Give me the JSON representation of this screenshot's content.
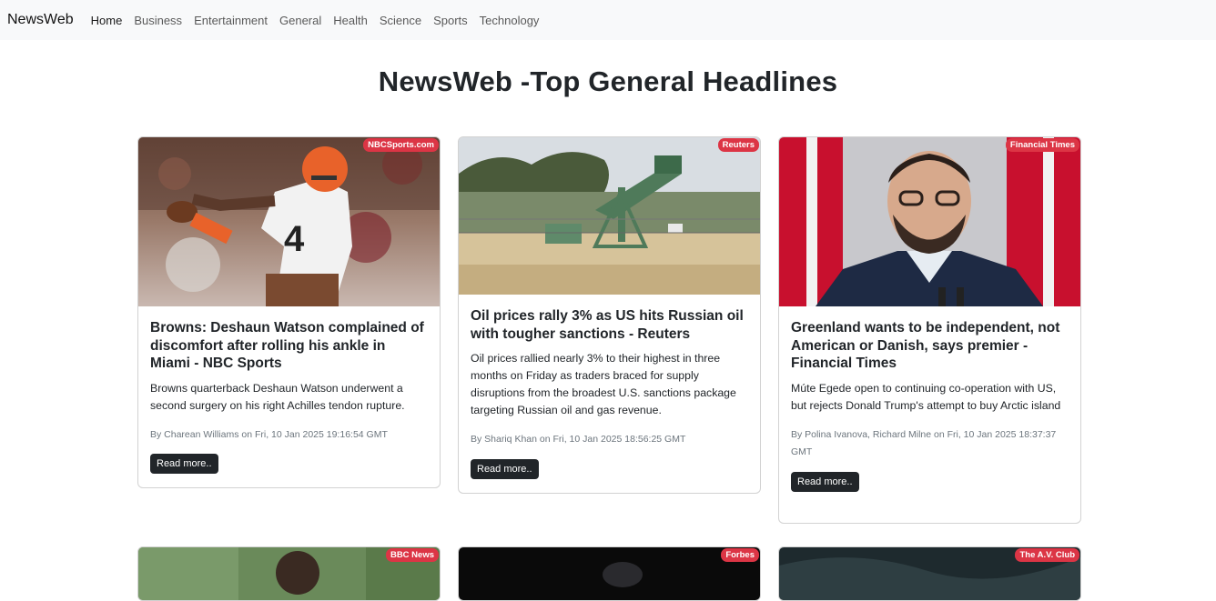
{
  "nav": {
    "brand": "NewsWeb",
    "links": [
      "Home",
      "Business",
      "Entertainment",
      "General",
      "Health",
      "Science",
      "Sports",
      "Technology"
    ]
  },
  "page": {
    "title": "NewsWeb -Top General Headlines"
  },
  "cards": [
    {
      "source": "NBCSports.com",
      "title": "Browns: Deshaun Watson complained of discomfort after rolling his ankle in Miami - NBC Sports",
      "description": "Browns quarterback Deshaun Watson underwent a second surgery on his right Achilles tendon rupture.",
      "meta": "By Charean Williams on Fri, 10 Jan 2025 19:16:54 GMT",
      "button": "Read more.."
    },
    {
      "source": "Reuters",
      "title": "Oil prices rally 3% as US hits Russian oil with tougher sanctions - Reuters",
      "description": "Oil prices rallied nearly 3% to their highest in three months on Friday as traders braced for supply disruptions from the broadest U.S. sanctions package targeting Russian oil and gas revenue.",
      "meta": "By Shariq Khan on Fri, 10 Jan 2025 18:56:25 GMT",
      "button": "Read more.."
    },
    {
      "source": "Financial Times",
      "title": "Greenland wants to be independent, not American or Danish, says premier - Financial Times",
      "description": "Múte Egede open to continuing co-operation with US, but rejects Donald Trump's attempt to buy Arctic island",
      "meta": "By Polina Ivanova, Richard Milne on Fri, 10 Jan 2025 18:37:37 GMT",
      "button": "Read more.."
    },
    {
      "source": "BBC News"
    },
    {
      "source": "Forbes"
    },
    {
      "source": "The A.V. Club"
    }
  ],
  "colors": {
    "badge": "#dc3545",
    "button": "#212529",
    "navbar": "#f8f9fa"
  }
}
